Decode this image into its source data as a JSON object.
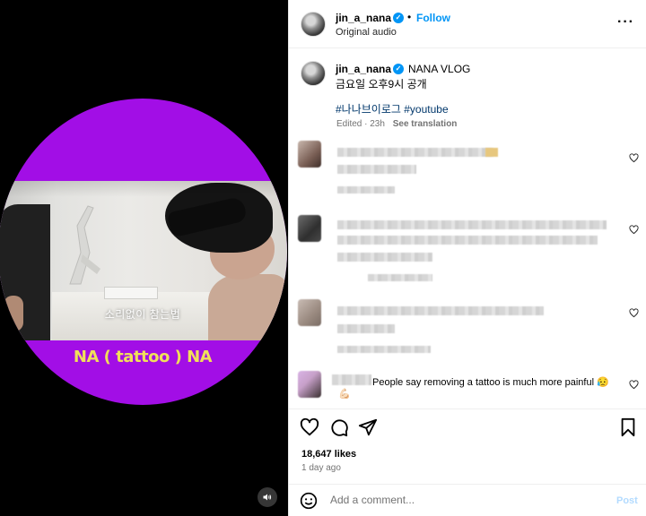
{
  "post": {
    "username": "jin_a_nana",
    "follow_label": "Follow",
    "audio_label": "Original audio",
    "caption_title": "NANA VLOG",
    "caption_line2": "금요일 오후9시 공개",
    "hashtags": "#나나브이로그 #youtube",
    "edited_label": "Edited · 23h",
    "see_translation": "See translation",
    "likes": "18,647 likes",
    "posted_ago": "1 day ago"
  },
  "video": {
    "subtitle": "소리없이 참는법",
    "title_caption": "NA ( tattoo ) NA",
    "accent_color": "#a20ee6"
  },
  "comments": [
    {
      "text": "",
      "visible": false
    },
    {
      "text": "",
      "visible": false
    },
    {
      "text": "",
      "visible": false
    },
    {
      "text": "People say removing a tattoo is much more painful 😥",
      "reaction": "💪🏻"
    }
  ],
  "composer": {
    "placeholder": "Add a comment...",
    "post_label": "Post"
  },
  "icons": [
    "more-icon",
    "heart-icon",
    "comment-icon",
    "share-icon",
    "bookmark-icon",
    "emoji-icon",
    "speaker-icon"
  ]
}
